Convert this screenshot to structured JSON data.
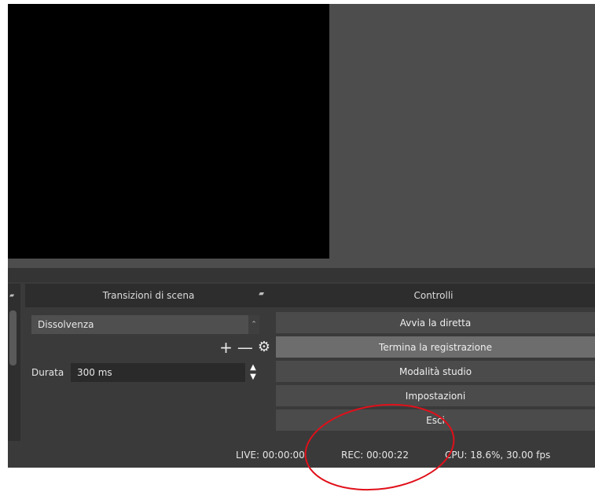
{
  "transitions": {
    "title": "Transizioni di scena",
    "selected": "Dissolvenza",
    "add_symbol": "+",
    "remove_symbol": "—",
    "gear_symbol": "⚙",
    "duration_label": "Durata",
    "duration_value": "300 ms"
  },
  "controls": {
    "title": "Controlli",
    "buttons": [
      {
        "label": "Avvia la diretta",
        "active": false
      },
      {
        "label": "Termina la registrazione",
        "active": true
      },
      {
        "label": "Modalità studio",
        "active": false
      },
      {
        "label": "Impostazioni",
        "active": false
      },
      {
        "label": "Esci",
        "active": false
      }
    ]
  },
  "status": {
    "live": "LIVE: 00:00:00",
    "rec": "REC: 00:00:22",
    "cpu": "CPU: 18.6%, 30.00 fps"
  },
  "icons": {
    "float": "float-dock-icon",
    "gear": "gear-icon",
    "add": "plus-icon",
    "remove": "minus-icon"
  },
  "colors": {
    "panel_bg": "#3a3a3a",
    "button_bg": "#4b4b4b",
    "button_active_bg": "#6d6d6d",
    "annotation": "#e0101a"
  }
}
